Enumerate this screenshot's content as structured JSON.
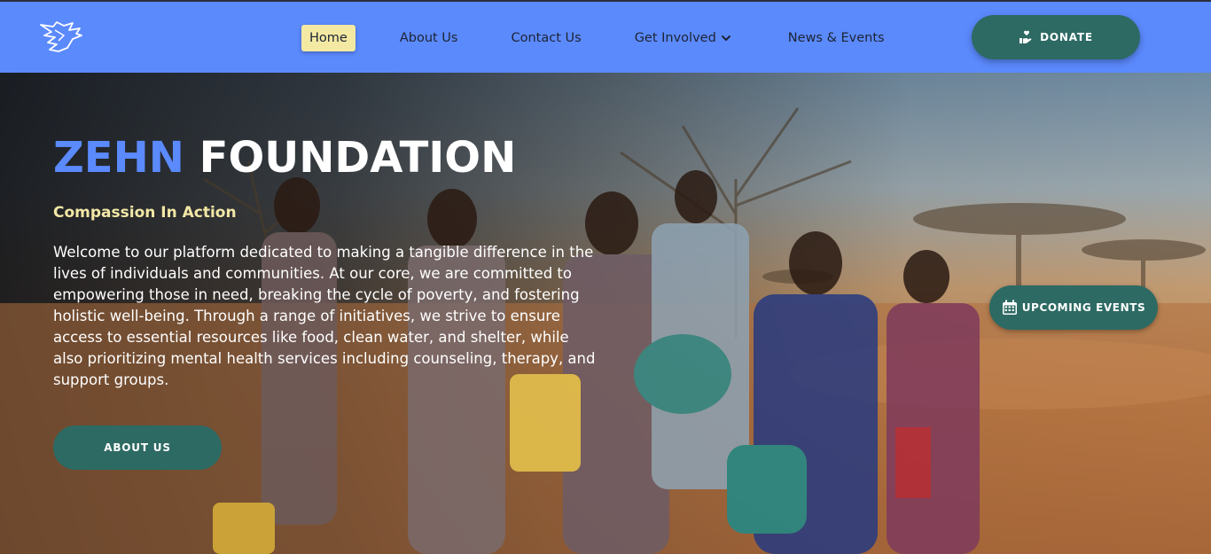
{
  "nav": {
    "logo_icon": "dove-logo-icon",
    "items": [
      {
        "label": "Home",
        "active": true
      },
      {
        "label": "About Us"
      },
      {
        "label": "Contact Us"
      },
      {
        "label": "Get Involved",
        "dropdown": true
      },
      {
        "label": "News & Events"
      }
    ],
    "donate": {
      "label": "DONATE",
      "icon": "hand-heart-icon"
    }
  },
  "hero": {
    "title_part1": "ZEHN",
    "title_part2": "FOUNDATION",
    "tagline": "Compassion In Action",
    "description": "Welcome to our platform dedicated to making a tangible difference in the lives of individuals and communities. At our core, we are committed to empowering those in need, breaking the cycle of poverty, and fostering holistic well-being. Through a range of initiatives, we strive to ensure access to essential resources like food, clean water, and shelter, while also prioritizing mental health services including counseling, therapy, and support groups.",
    "about_button": "ABOUT US",
    "events_button": "UPCOMING EVENTS",
    "events_icon": "calendar-icon"
  },
  "colors": {
    "nav_bg": "#5b8afd",
    "accent_green": "#2d6a63",
    "home_highlight": "#f3e9a3",
    "tagline": "#f2e7a6",
    "title_blue": "#5b8afd"
  }
}
